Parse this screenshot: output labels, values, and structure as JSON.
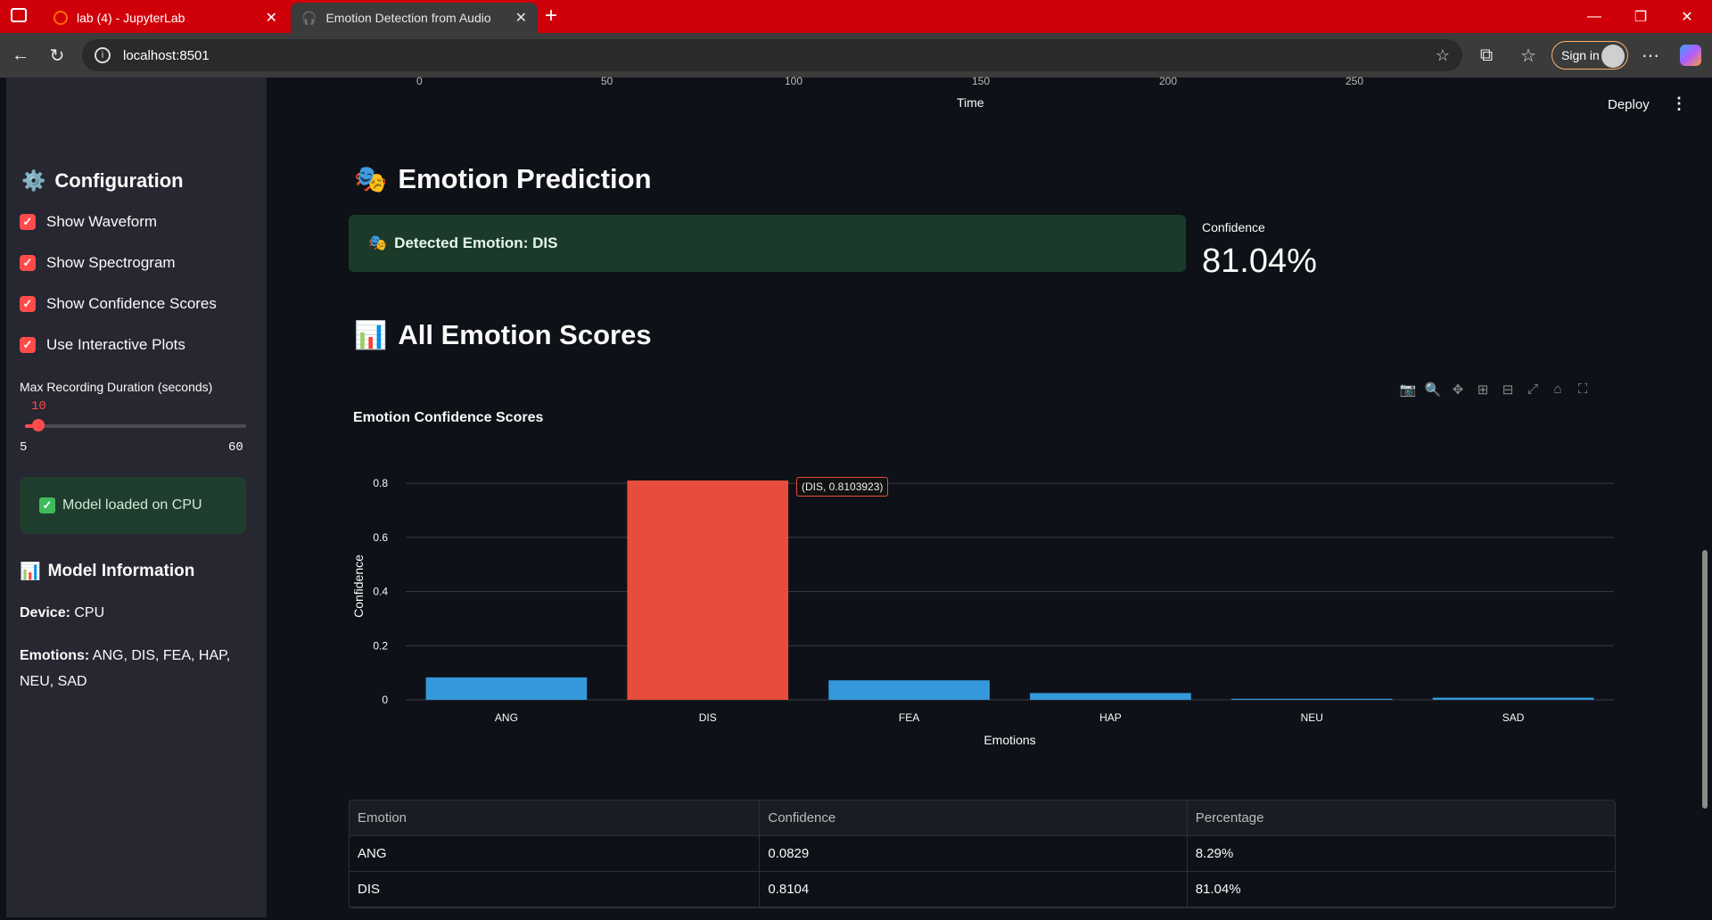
{
  "browser": {
    "tabs": [
      {
        "label": "lab (4) - JupyterLab"
      },
      {
        "label": "Emotion Detection from Audio"
      }
    ],
    "url": "localhost:8501",
    "sign_in": "Sign in"
  },
  "sidebar": {
    "config_title": "Configuration",
    "options": [
      {
        "label": "Show Waveform",
        "checked": true
      },
      {
        "label": "Show Spectrogram",
        "checked": true
      },
      {
        "label": "Show Confidence Scores",
        "checked": true
      },
      {
        "label": "Use Interactive Plots",
        "checked": true
      }
    ],
    "slider": {
      "label": "Max Recording Duration (seconds)",
      "value": "10",
      "min": "5",
      "max": "60"
    },
    "status": "Model loaded on CPU",
    "model_info_title": "Model Information",
    "device_label": "Device:",
    "device_value": "CPU",
    "emotions_label": "Emotions:",
    "emotions_value": "ANG, DIS, FEA, HAP, NEU, SAD"
  },
  "main": {
    "top_axis_ticks": [
      "0",
      "50",
      "100",
      "150",
      "200",
      "250"
    ],
    "top_axis_title": "Time",
    "deploy": "Deploy",
    "prediction_title": "Emotion Prediction",
    "detected": "Detected Emotion: DIS",
    "confidence_label": "Confidence",
    "confidence_value": "81.04%",
    "scores_title": "All Emotion Scores",
    "tooltip": "(DIS, 0.8103923)"
  },
  "chart_data": {
    "type": "bar",
    "title": "Emotion Confidence Scores",
    "xlabel": "Emotions",
    "ylabel": "Confidence",
    "categories": [
      "ANG",
      "DIS",
      "FEA",
      "HAP",
      "NEU",
      "SAD"
    ],
    "values": [
      0.0829,
      0.8104,
      0.072,
      0.025,
      0.004,
      0.008
    ],
    "highlight_index": 1,
    "ylim": [
      0,
      0.84
    ],
    "yticks": [
      0,
      0.2,
      0.4,
      0.6,
      0.8
    ],
    "ytick_labels": [
      "0",
      "0.2",
      "0.4",
      "0.6",
      "0.8"
    ],
    "colors": {
      "default": "#3498db",
      "highlight": "#e74c3c"
    },
    "grid": true
  },
  "table": {
    "headers": [
      "Emotion",
      "Confidence",
      "Percentage"
    ],
    "rows": [
      [
        "ANG",
        "0.0829",
        "8.29%"
      ],
      [
        "DIS",
        "0.8104",
        "81.04%"
      ]
    ]
  }
}
